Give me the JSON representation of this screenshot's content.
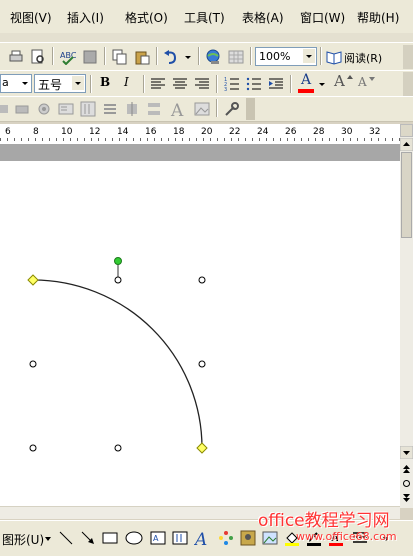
{
  "menu": {
    "items": [
      {
        "label": "视图(V)"
      },
      {
        "label": "插入(I)"
      },
      {
        "label": "格式(O)"
      },
      {
        "label": "工具(T)"
      },
      {
        "label": "表格(A)"
      },
      {
        "label": "窗口(W)"
      },
      {
        "label": "帮助(H)"
      }
    ]
  },
  "toolbar_standard": {
    "zoom_value": "100%",
    "read_label": "阅读(R)"
  },
  "toolbar_format": {
    "style_value": "a",
    "font_size_value": "五号",
    "bold_label": "B",
    "italic_label": "I",
    "font_color_label": "A",
    "grow_font_label": "A",
    "shrink_font_label": "A",
    "font_color": "#ff0000"
  },
  "ruler": {
    "numbers": [
      "6",
      "8",
      "10",
      "12",
      "14",
      "16",
      "18",
      "20",
      "22",
      "24",
      "26",
      "28",
      "30",
      "32"
    ]
  },
  "drawing_toolbar": {
    "label": "图形(U)"
  },
  "watermark": {
    "main_text": "office教程学习网",
    "url_text": "www.office68.com"
  },
  "colors": {
    "handle_yellow": "#ffff66",
    "handle_green": "#33cc33",
    "watermark": "#ff3333"
  }
}
